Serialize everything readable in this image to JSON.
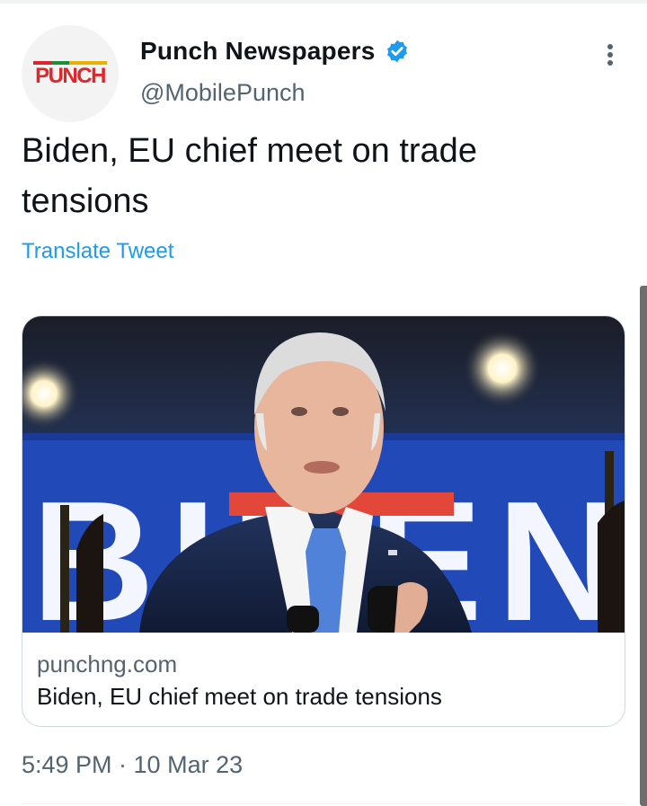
{
  "tweet": {
    "author": {
      "name": "Punch Newspapers",
      "handle": "@MobilePunch",
      "avatar_text": "PUNCH",
      "verified": true
    },
    "text": "Biden, EU chief meet on trade tensions",
    "translate_label": "Translate Tweet",
    "card": {
      "domain": "punchng.com",
      "title": "Biden, EU chief meet on trade tensions",
      "image_text": "BIDEN"
    },
    "timestamp": "5:49 PM · 10 Mar 23"
  },
  "icons": {
    "verified": "verified-badge-icon",
    "more": "more-options-icon"
  },
  "colors": {
    "accent": "#1d9bf0",
    "secondary_text": "#536471",
    "primary_text": "#0f1419",
    "brand_red": "#e0262b"
  }
}
